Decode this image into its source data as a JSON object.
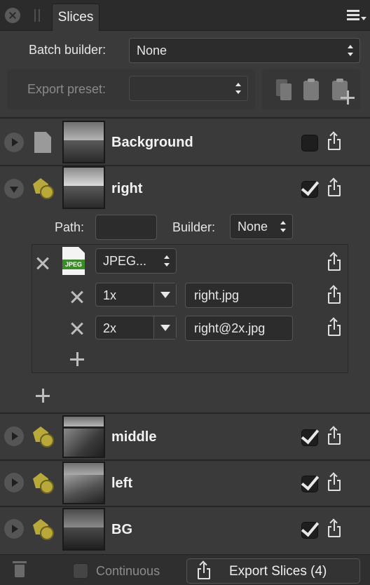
{
  "panel": {
    "tab_label": "Slices"
  },
  "batch": {
    "label": "Batch builder:",
    "value": "None"
  },
  "preset": {
    "label": "Export preset:",
    "value": ""
  },
  "layers": [
    {
      "name": "Background",
      "expanded": false,
      "checked": false,
      "icon": "page-icon"
    },
    {
      "name": "right",
      "expanded": true,
      "checked": true,
      "icon": "slice-icon"
    },
    {
      "name": "middle",
      "expanded": false,
      "checked": true,
      "icon": "slice-icon"
    },
    {
      "name": "left",
      "expanded": false,
      "checked": true,
      "icon": "slice-icon"
    },
    {
      "name": "BG",
      "expanded": false,
      "checked": true,
      "icon": "slice-icon"
    }
  ],
  "detail": {
    "path_label": "Path:",
    "path_value": "",
    "builder_label": "Builder:",
    "builder_value": "None",
    "format": "JPEG...",
    "format_badge": "JPEG",
    "outputs": [
      {
        "scale": "1x",
        "filename": "right.jpg"
      },
      {
        "scale": "2x",
        "filename": "right@2x.jpg"
      }
    ]
  },
  "footer": {
    "continuous_label": "Continuous",
    "export_label": "Export Slices (4)"
  }
}
